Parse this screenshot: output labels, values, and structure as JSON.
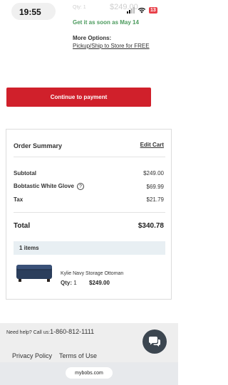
{
  "status_bar": {
    "time": "19:55",
    "battery": "13"
  },
  "cart_item_top": {
    "qty": "Qty: 1",
    "price": "$249.00"
  },
  "delivery": {
    "text": "Get it as soon as May 14"
  },
  "more_options": {
    "label": "More Options:",
    "link": "Pickup/Ship to Store for FREE"
  },
  "continue_button": {
    "label": "Continue to payment"
  },
  "order_summary": {
    "title": "Order Summary",
    "edit_cart": "Edit Cart",
    "subtotal_label": "Subtotal",
    "subtotal_value": "$249.00",
    "glove_label": "Bobtastic White Glove",
    "glove_value": "$69.99",
    "tax_label": "Tax",
    "tax_value": "$21.79",
    "total_label": "Total",
    "total_value": "$340.78",
    "items_count": "1 items",
    "product": {
      "name": "Kylie Navy Storage Ottoman",
      "qty_label": "Qty:",
      "qty_value": "1",
      "price": "$249.00"
    }
  },
  "help": {
    "text": "Need help? Call us:",
    "phone": "1-860-812-1111"
  },
  "footer": {
    "privacy": "Privacy Policy",
    "terms": "Terms of Use"
  },
  "browser": {
    "url": "mybobs.com"
  },
  "colors": {
    "accent": "#d0202b",
    "delivery_green": "#4a9a5c",
    "items_bar": "#e8eff3"
  }
}
